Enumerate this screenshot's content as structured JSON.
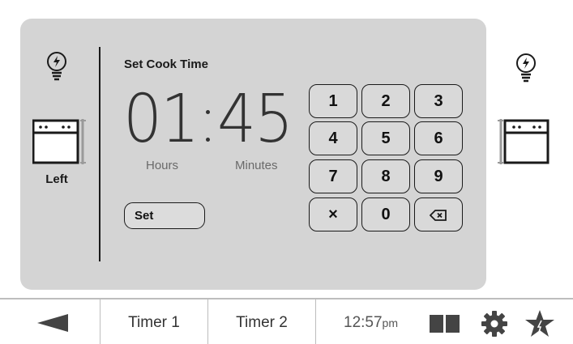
{
  "screen": {
    "title": "Set Cook Time",
    "hours": "01",
    "minutes": "45",
    "hours_label": "Hours",
    "minutes_label": "Minutes",
    "set_label": "Set"
  },
  "left_oven": {
    "label": "Left",
    "icon": "oven-icon"
  },
  "right_oven": {
    "icon": "oven-icon"
  },
  "keypad": {
    "keys": [
      "1",
      "2",
      "3",
      "4",
      "5",
      "6",
      "7",
      "8",
      "9",
      "×",
      "0"
    ],
    "backspace_icon": "backspace-icon"
  },
  "bottom_bar": {
    "back_icon": "back-arrow-icon",
    "timer1_label": "Timer 1",
    "timer2_label": "Timer 2",
    "time": "12:57",
    "ampm": "pm",
    "icons": [
      "grid-icon",
      "gear-icon",
      "star-icon"
    ]
  },
  "colors": {
    "panel": "#d4d4d4",
    "text": "#1a1a1a",
    "muted": "#6a6a6a"
  }
}
